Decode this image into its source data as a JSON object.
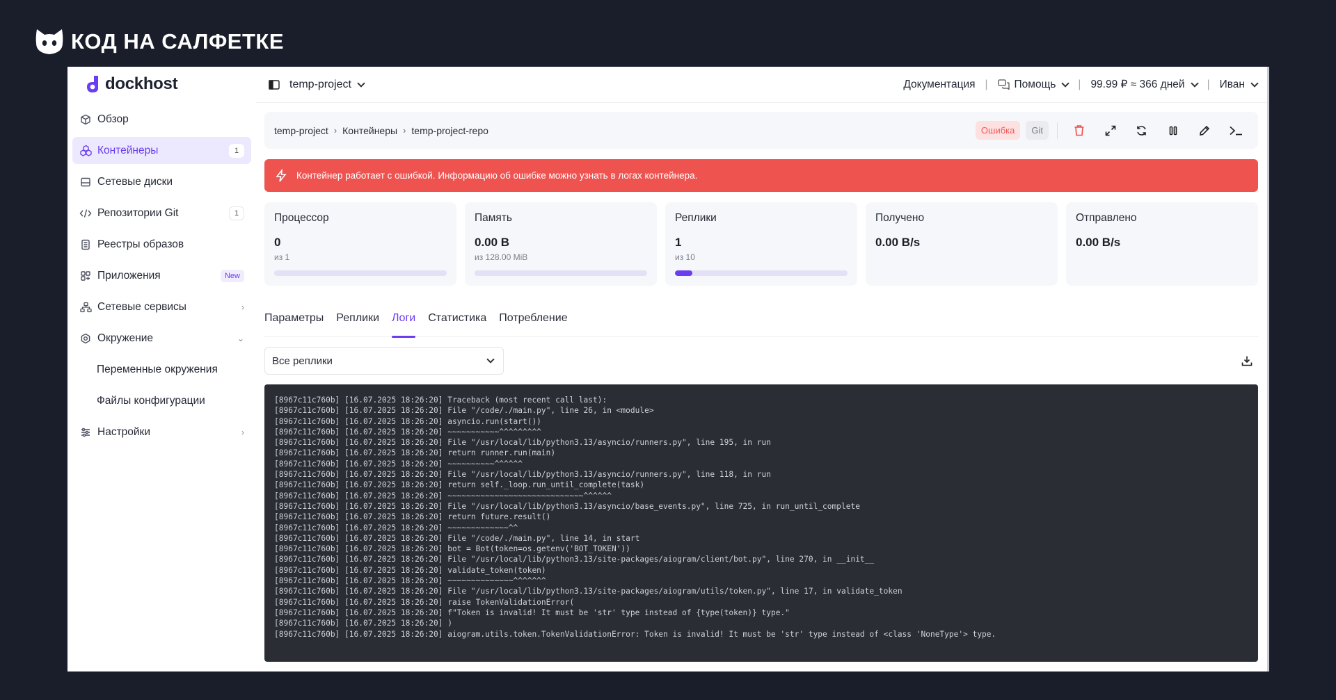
{
  "watermark": {
    "text": "КОД НА САЛФЕТКЕ"
  },
  "app": {
    "logo_text": "dockhost"
  },
  "sidebar": {
    "items": [
      {
        "label": "Обзор",
        "icon": "cube-icon"
      },
      {
        "label": "Контейнеры",
        "icon": "containers-icon",
        "badge": "1"
      },
      {
        "label": "Сетевые диски",
        "icon": "disk-icon"
      },
      {
        "label": "Репозитории Git",
        "icon": "code-icon",
        "badge": "1"
      },
      {
        "label": "Реестры образов",
        "icon": "registry-icon"
      },
      {
        "label": "Приложения",
        "icon": "apps-icon",
        "tag": "New"
      },
      {
        "label": "Сетевые сервисы",
        "icon": "network-icon"
      },
      {
        "label": "Окружение",
        "icon": "environment-icon"
      },
      {
        "label": "Настройки",
        "icon": "sliders-icon"
      }
    ],
    "sub_items": [
      "Переменные окружения",
      "Файлы конфигурации"
    ]
  },
  "topbar": {
    "project": "temp-project",
    "docs": "Документация",
    "help": "Помощь",
    "balance": "99.99 ₽ ≈ 366 дней",
    "user": "Иван"
  },
  "breadcrumb": [
    "temp-project",
    "Контейнеры",
    "temp-project-repo"
  ],
  "status": {
    "error": "Ошибка",
    "git": "Git"
  },
  "alert": {
    "text": "Контейнер работает с ошибкой. Информацию об ошибке можно узнать в логах контейнера."
  },
  "stats": [
    {
      "title": "Процессор",
      "value": "0",
      "sub": "из 1",
      "progress": 0
    },
    {
      "title": "Память",
      "value": "0.00 B",
      "sub": "из 128.00 MiB",
      "progress": 0
    },
    {
      "title": "Реплики",
      "value": "1",
      "sub": "из 10",
      "progress": 0.1
    },
    {
      "title": "Получено",
      "value": "0.00 B/s"
    },
    {
      "title": "Отправлено",
      "value": "0.00 B/s"
    }
  ],
  "tabs": [
    "Параметры",
    "Реплики",
    "Логи",
    "Статистика",
    "Потребление"
  ],
  "active_tab": "Логи",
  "replica_select": {
    "value": "Все реплики"
  },
  "logs": [
    "[8967c11c760b] [16.07.2025 18:26:20] Traceback (most recent call last):",
    "[8967c11c760b] [16.07.2025 18:26:20] File \"/code/./main.py\", line 26, in <module>",
    "[8967c11c760b] [16.07.2025 18:26:20] asyncio.run(start())",
    "[8967c11c760b] [16.07.2025 18:26:20] ~~~~~~~~~~~^^^^^^^^^",
    "[8967c11c760b] [16.07.2025 18:26:20] File \"/usr/local/lib/python3.13/asyncio/runners.py\", line 195, in run",
    "[8967c11c760b] [16.07.2025 18:26:20] return runner.run(main)",
    "[8967c11c760b] [16.07.2025 18:26:20] ~~~~~~~~~~^^^^^^",
    "[8967c11c760b] [16.07.2025 18:26:20] File \"/usr/local/lib/python3.13/asyncio/runners.py\", line 118, in run",
    "[8967c11c760b] [16.07.2025 18:26:20] return self._loop.run_until_complete(task)",
    "[8967c11c760b] [16.07.2025 18:26:20] ~~~~~~~~~~~~~~~~~~~~~~~~~~~~~^^^^^^",
    "[8967c11c760b] [16.07.2025 18:26:20] File \"/usr/local/lib/python3.13/asyncio/base_events.py\", line 725, in run_until_complete",
    "[8967c11c760b] [16.07.2025 18:26:20] return future.result()",
    "[8967c11c760b] [16.07.2025 18:26:20] ~~~~~~~~~~~~~^^",
    "[8967c11c760b] [16.07.2025 18:26:20] File \"/code/./main.py\", line 14, in start",
    "[8967c11c760b] [16.07.2025 18:26:20] bot = Bot(token=os.getenv('BOT_TOKEN'))",
    "[8967c11c760b] [16.07.2025 18:26:20] File \"/usr/local/lib/python3.13/site-packages/aiogram/client/bot.py\", line 270, in __init__",
    "[8967c11c760b] [16.07.2025 18:26:20] validate_token(token)",
    "[8967c11c760b] [16.07.2025 18:26:20] ~~~~~~~~~~~~~~^^^^^^^",
    "[8967c11c760b] [16.07.2025 18:26:20] File \"/usr/local/lib/python3.13/site-packages/aiogram/utils/token.py\", line 17, in validate_token",
    "[8967c11c760b] [16.07.2025 18:26:20] raise TokenValidationError(",
    "[8967c11c760b] [16.07.2025 18:26:20] f\"Token is invalid! It must be 'str' type instead of {type(token)} type.\"",
    "[8967c11c760b] [16.07.2025 18:26:20] )",
    "[8967c11c760b] [16.07.2025 18:26:20] aiogram.utils.token.TokenValidationError: Token is invalid! It must be 'str' type instead of <class 'NoneType'> type."
  ],
  "colors": {
    "accent": "#6a3df0",
    "error": "#ef5350",
    "log_bg": "#2a2d34",
    "frame": "#1a1e2b"
  }
}
